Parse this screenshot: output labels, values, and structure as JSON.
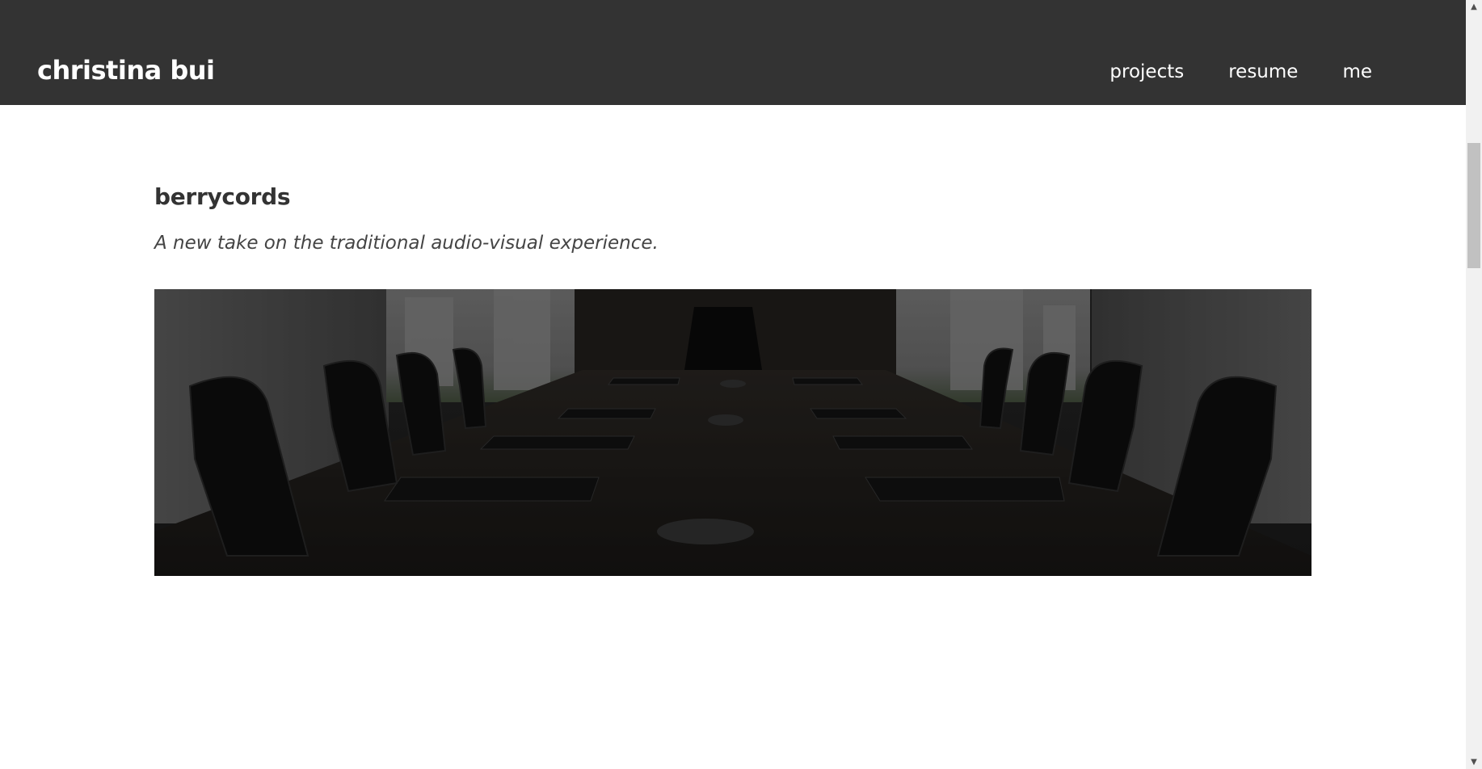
{
  "header": {
    "brand": "christina bui",
    "nav": [
      "projects",
      "resume",
      "me"
    ]
  },
  "project": {
    "title": "berrycords",
    "tagline": "A new take on the traditional audio-visual experience.",
    "hero_image": "conference-room-photo"
  },
  "colors": {
    "navbar_bg": "#333333",
    "text": "#333333",
    "background": "#ffffff"
  }
}
